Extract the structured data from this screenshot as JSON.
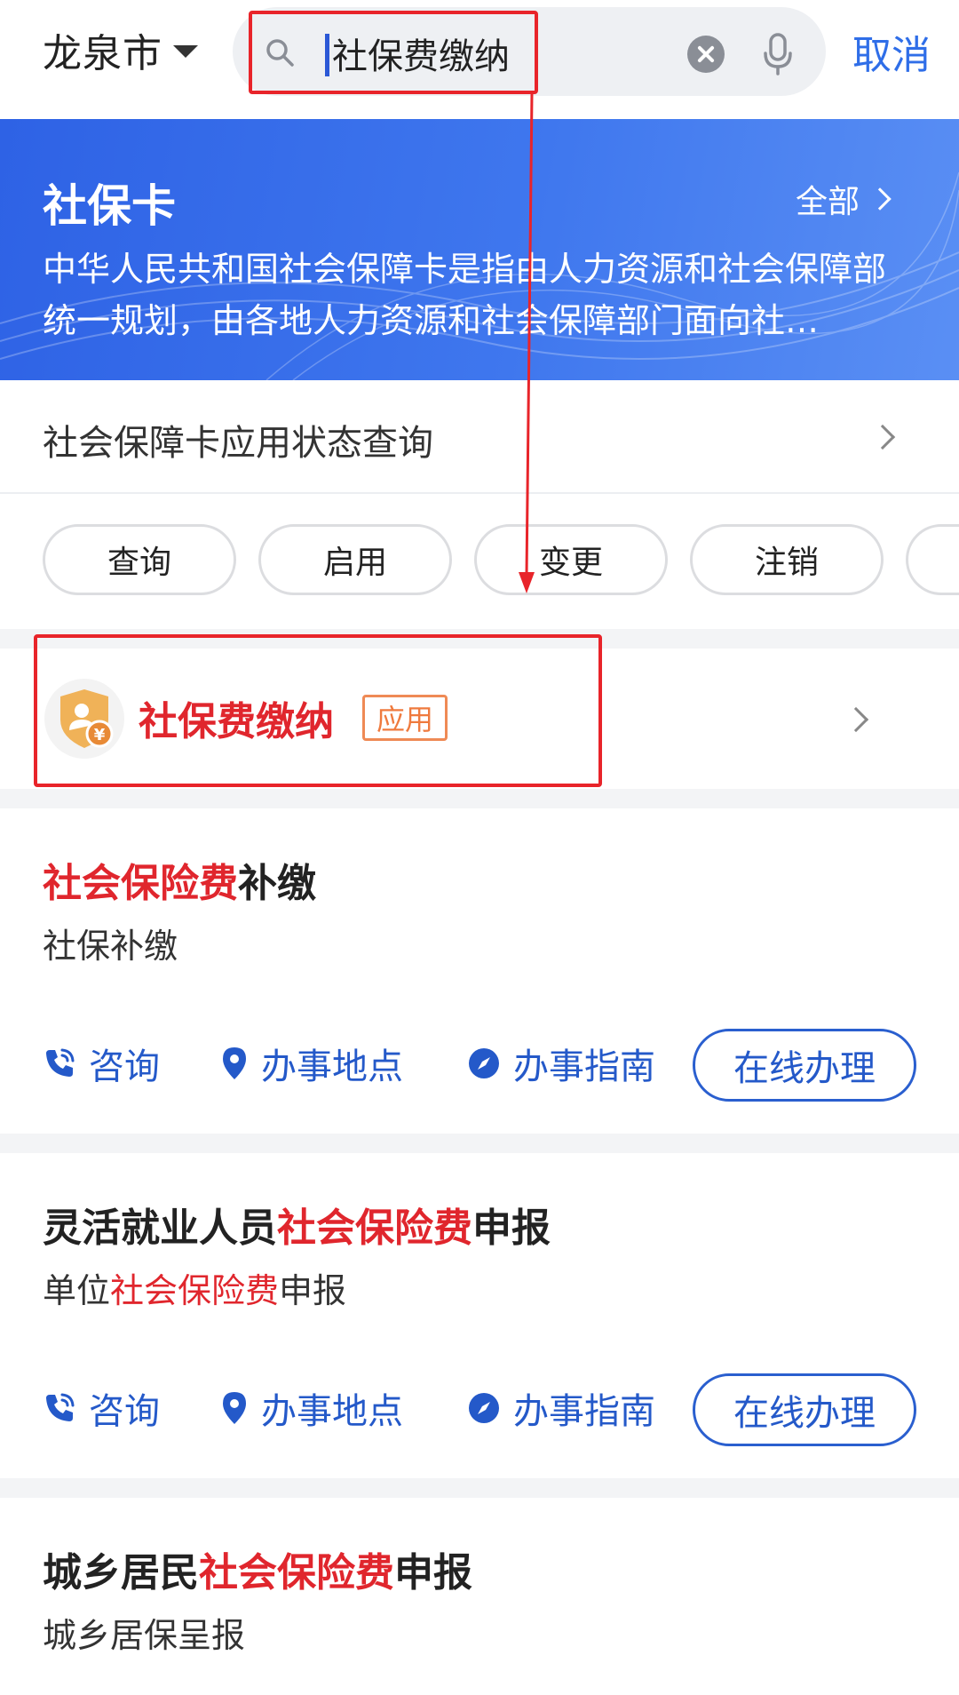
{
  "header": {
    "city": "龙泉市",
    "search": {
      "value": "社保费缴纳"
    },
    "cancel_label": "取消"
  },
  "card": {
    "title": "社保卡",
    "all_label": "全部",
    "description": "中华人民共和国社会保障卡是指由人力资源和社会保障部统一规划，由各地人力资源和社会保障部门面向社…",
    "status_query": "社会保障卡应用状态查询",
    "chips": [
      "查询",
      "启用",
      "变更",
      "注销"
    ]
  },
  "app_result": {
    "name": "社保费缴纳",
    "tag": "应用"
  },
  "services": [
    {
      "title_hl": "社会保险费",
      "title_rest": "补缴",
      "sub_plain": "社保补缴",
      "actions": {
        "consult": "咨询",
        "location": "办事地点",
        "guide": "办事指南",
        "online": "在线办理"
      }
    },
    {
      "title_pre": "灵活就业人员",
      "title_hl": "社会保险费",
      "title_rest": "申报",
      "sub_pre": "单位",
      "sub_hl": "社会保险费",
      "sub_rest": "申报",
      "actions": {
        "consult": "咨询",
        "location": "办事地点",
        "guide": "办事指南",
        "online": "在线办理"
      }
    },
    {
      "title_pre": "城乡居民",
      "title_hl": "社会保险费",
      "title_rest": "申报",
      "sub_plain": "城乡居保呈报"
    }
  ],
  "colors": {
    "accent_blue": "#2f6ee8",
    "highlight_red": "#e0262d",
    "annotation_red": "#e8242a",
    "tag_orange": "#ef7a3e"
  }
}
